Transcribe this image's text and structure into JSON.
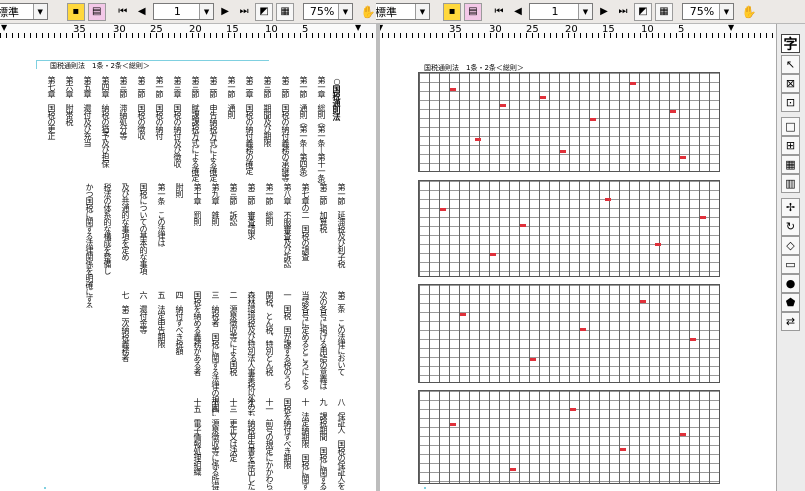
{
  "left_toolbar": {
    "style_value": "標準",
    "page_value": "1",
    "zoom_value": "75%"
  },
  "right_toolbar": {
    "style_value": "標準",
    "page_value": "1",
    "zoom_value": "75%"
  },
  "icons": {
    "first_page": "⏮",
    "prev_page": "◀",
    "next_page": "▶",
    "last_page": "⏭",
    "hand": "✋",
    "dropdown": "▼"
  },
  "left_ruler": {
    "labels": [
      "35",
      "30",
      "25",
      "20",
      "15",
      "10",
      "5"
    ]
  },
  "right_ruler": {
    "labels": [
      "35",
      "30",
      "25",
      "20",
      "15",
      "10",
      "5"
    ]
  },
  "left_page": {
    "header": "国税通則法　1条・2条＜総則＞",
    "title": "○国税通則法",
    "blocks": [
      [
        "第一章　総則（第一条―第十一条）",
        "第一節　通則（第一条―第四条）",
        "第二節　国税の納付義務の承継等",
        "第三節　期間及び期限",
        "第二章　国税の納付義務の確定",
        "第一節　通則",
        "第二節　申告納税方式による確定",
        "第三節　賦課課税方式による確定",
        "第三章　国税の納付及び徴収",
        "第一節　国税の納付",
        "第二節　国税の徴収",
        "第三節　滞納処分等",
        "第四章　納税の猶予及び担保",
        "第五章　還付及び充当",
        "第六章　附帯税",
        "第七章　国税の更正"
      ],
      [
        "第一節　延滞税及び利子税",
        "第二節　加算税",
        "第七章の二　国税の調査",
        "第八章　不服審査及び訴訟",
        "第一節　総則",
        "第二節　審査請求",
        "第三節　訴訟",
        "第九章　雑則",
        "第十章　罰則",
        "附則",
        "第一条　この法律は",
        "国税についての基本的な事項",
        "及び共通的な事項を定め",
        "税法の体系的な構成を整備し",
        "かつ国税に関する法律関係を明確にする"
      ],
      [
        "第二条　この法律において",
        "次の各号に掲げる用語の意義は",
        "当該各号に定めるところによる",
        "一　国税　国が課する税のうち",
        "関税、とん税、特別とん税",
        "森林環境税及び特別法人事業税以外のもの",
        "二　源泉徴収等による国税",
        "三　納税者　国税に関する法律の規定により",
        "国税を納める義務がある者",
        "四　納付すべき税額",
        "五　法定申告期限",
        "六　還付金等",
        "七　第二次納税義務者"
      ],
      [
        "八　保証人　国税の保証人をいう",
        "九　課税期間　国税に関する法律の規定により",
        "十　法定納期限　国税に関する法律の規定により",
        "国税を納付すべき期限",
        "十一　前号の規定にかかわらず",
        "十二　納税申告書を提出した者",
        "十三　更正又は決定",
        "十四　源泉徴収等に係る所得税",
        "十五　電子情報処理組織"
      ]
    ]
  },
  "right_page": {
    "header": "国税通則法　1条・2条＜総則＞"
  },
  "vertical_tools": [
    "字",
    "↖",
    "⊠",
    "⊡",
    "□",
    "⊞",
    "▦",
    "▥",
    "✢",
    "↻",
    "◇",
    "▭",
    "●",
    "⬟",
    "⇄"
  ]
}
